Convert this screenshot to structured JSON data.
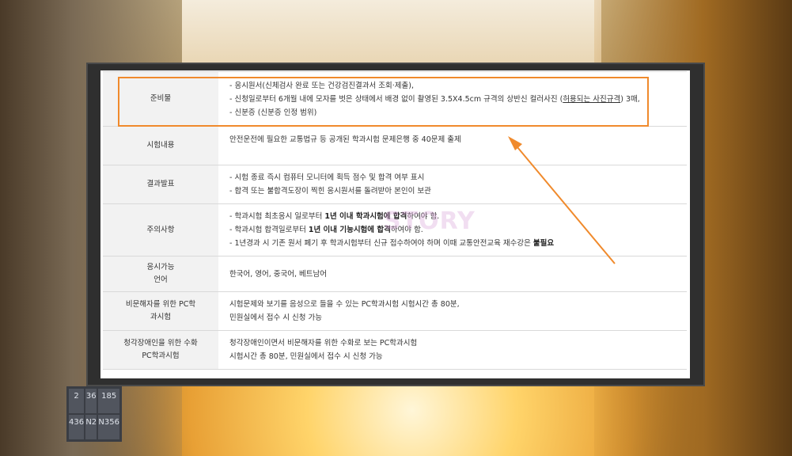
{
  "background_sign": [
    "2",
    "36",
    "185",
    "436",
    "N2",
    "N356"
  ],
  "watermark": "STORY",
  "table": {
    "rows": [
      {
        "head": "준비물",
        "lines": [
          [
            "- 응시원서(신체검사 완료 또는 건강검진결과서 조회·제출),"
          ],
          [
            "- 신청일로부터 6개월 내에 모자를 벗은 상태에서 배경 없이 촬영된 3.5X4.5cm 규격의 상반신 컬러사진 (",
            "허용되는 사진규격",
            ") 3매,"
          ],
          [
            "- 신분증 (신분증 인정 범위)"
          ]
        ]
      },
      {
        "head": "시험내용",
        "lines": [
          [
            "안전운전에 필요한 교통법규 등 공개된 학과시험 문제은행 중 40문제 출제"
          ]
        ]
      },
      {
        "head": "결과발표",
        "lines": [
          [
            "- 시험 종료 즉시 컴퓨터 모니터에 획득 점수 및 합격 여부 표시"
          ],
          [
            "- 합격 또는 불합격도장이 찍힌 응시원서를 돌려받아 본인이 보관"
          ]
        ]
      },
      {
        "head": "주의사항",
        "lines": [
          [
            "- 학과시험 최초응시 일로부터 ",
            "1년 이내 학과시험에 합격",
            "하여야 함."
          ],
          [
            "- 학과시험 합격일로부터 ",
            "1년 이내 기능시험에 합격",
            "하여야 함."
          ],
          [
            "- 1년경과 시 기존 원서 폐기 후 학과시험부터 신규 접수하여야 하며 이때 교통안전교육 재수강은 ",
            "불필요",
            ""
          ]
        ]
      },
      {
        "head": [
          "응시가능",
          "언어"
        ],
        "lines": [
          [
            "한국어, 영어, 중국어, 베트남어"
          ]
        ]
      },
      {
        "head": [
          "비문해자를 위한 PC학",
          "과시험"
        ],
        "lines": [
          [
            "시험문제와 보기를 음성으로 들을 수 있는 PC학과시험 시험시간 총 80분,"
          ],
          [
            "민원실에서 접수 시 신청 가능"
          ]
        ]
      },
      {
        "head": [
          "청각장애인을 위한 수화",
          "PC학과시험"
        ],
        "lines": [
          [
            "청각장애인이면서 비문해자를 위한 수화로 보는 PC학과시험"
          ],
          [
            "시험시간 총 80분, 민원실에서 접수 시 신청 가능"
          ]
        ]
      }
    ]
  },
  "colors": {
    "highlight": "#f08a2c",
    "head_bg": "#f2f2f2",
    "frame": "#2f2f2f"
  }
}
